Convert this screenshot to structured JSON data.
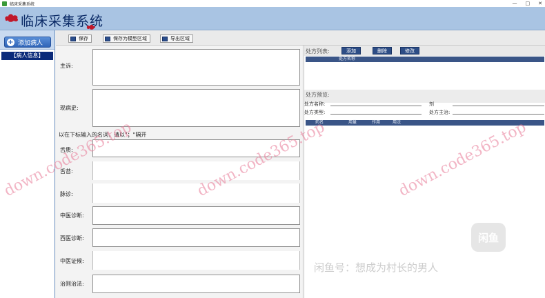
{
  "window": {
    "title": "临床采集系统",
    "min_glyph": "—",
    "max_glyph": "□",
    "close_glyph": "✕"
  },
  "banner": {
    "brand": "临床采集系统"
  },
  "sidebar": {
    "add_button": "添加病人",
    "items": [
      {
        "label": "【病人信息】"
      }
    ]
  },
  "toolbar": {
    "save": "保存",
    "save_template": "保存为模型区域",
    "export": "导出区域"
  },
  "form": {
    "chief_complaint": "主诉:",
    "present_illness": "现病史:",
    "hint": "以在下标输入的名词，请以\"；\"隔开",
    "tongue": "舌质:",
    "coating": "舌苔:",
    "pulse": "脉诊:",
    "tcm_diagnosis": "中医诊断:",
    "western_diagnosis": "西医诊断:",
    "tcm_syndrome": "中医证候:",
    "treatment": "治则治法:"
  },
  "right": {
    "list_title": "处方列表:",
    "add": "添加",
    "delete": "删除",
    "edit": "修改",
    "list_col": "处方名称",
    "preview_title": "处方预览:",
    "pv_name": "处方名称:",
    "pv_dosage_form": "剂",
    "pv_type": "处方类型:",
    "pv_main": "处方主治:",
    "cols": [
      "药名",
      "用量",
      "作用",
      "用法"
    ]
  },
  "watermark": {
    "text": "down.code365.top",
    "xianyu_badge": "闲鱼",
    "xianyu_text": "闲鱼号：想成为村长的男人"
  },
  "colors": {
    "banner": "#a9c4e3",
    "brand_text": "#0a2a66",
    "button_blue": "#2d4d86",
    "selected_item": "#0a2a7a"
  }
}
